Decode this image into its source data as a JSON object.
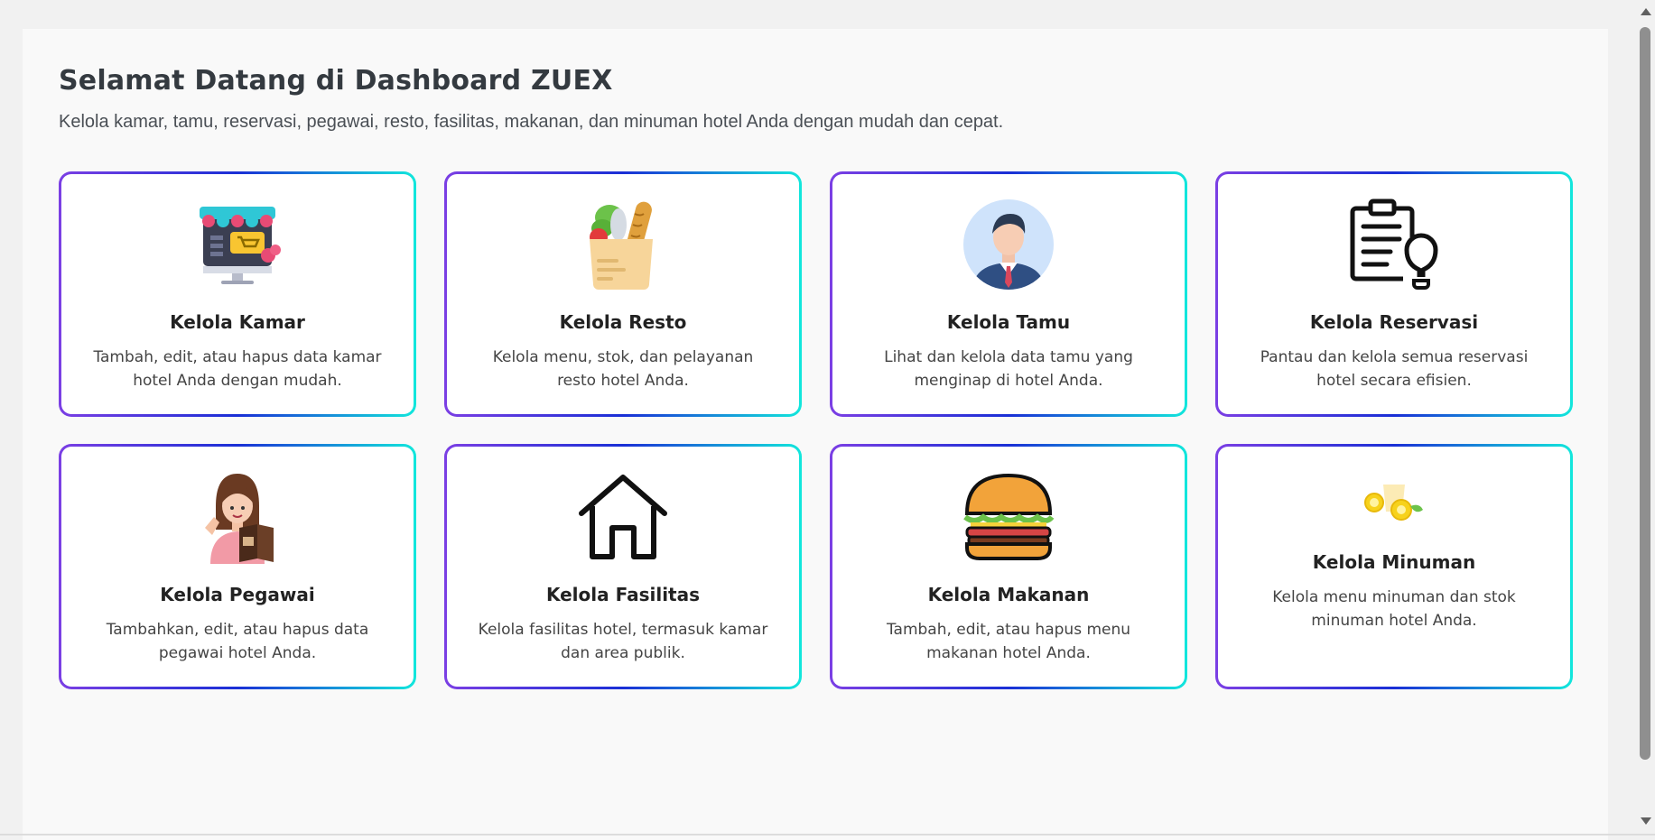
{
  "header": {
    "title": "Selamat Datang di Dashboard ZUEX",
    "subtitle": "Kelola kamar, tamu, reservasi, pegawai, resto, fasilitas, makanan, dan minuman hotel Anda dengan mudah dan cepat."
  },
  "cards": [
    {
      "title": "Kelola Kamar",
      "desc": "Tambah, edit, atau hapus data kamar hotel Anda dengan mudah.",
      "icon": "online-store-icon"
    },
    {
      "title": "Kelola Resto",
      "desc": "Kelola menu, stok, dan pelayanan resto hotel Anda.",
      "icon": "grocery-bag-icon"
    },
    {
      "title": "Kelola Tamu",
      "desc": "Lihat dan kelola data tamu yang menginap di hotel Anda.",
      "icon": "businessman-avatar-icon"
    },
    {
      "title": "Kelola Reservasi",
      "desc": "Pantau dan kelola semua reservasi hotel secara efisien.",
      "icon": "clipboard-idea-icon"
    },
    {
      "title": "Kelola Pegawai",
      "desc": "Tambahkan, edit, atau hapus data pegawai hotel Anda.",
      "icon": "waitress-menu-icon"
    },
    {
      "title": "Kelola Fasilitas",
      "desc": "Kelola fasilitas hotel, termasuk kamar dan area publik.",
      "icon": "house-icon"
    },
    {
      "title": "Kelola Makanan",
      "desc": "Tambah, edit, atau hapus menu makanan hotel Anda.",
      "icon": "burger-icon"
    },
    {
      "title": "Kelola Minuman",
      "desc": "Kelola menu minuman dan stok minuman hotel Anda.",
      "icon": "lemon-drink-icon"
    }
  ],
  "colors": {
    "card_border_gradient": [
      "#7b3fe4",
      "#1a2fd6",
      "#12e7dc"
    ],
    "title": "#343a40",
    "background": "#f9f9f9"
  }
}
